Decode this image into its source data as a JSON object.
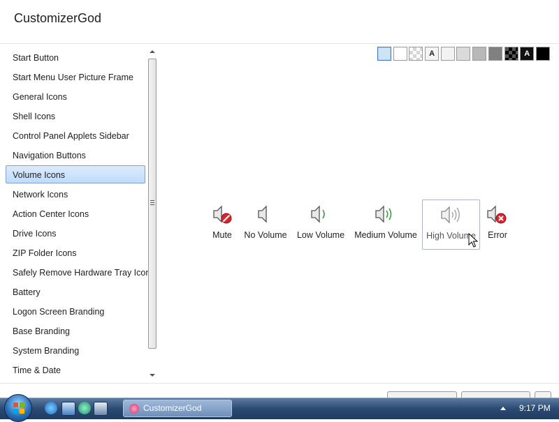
{
  "app": {
    "title": "CustomizerGod"
  },
  "sidebar": {
    "items": [
      {
        "label": "Start Button",
        "selected": false
      },
      {
        "label": "Start Menu User Picture Frame",
        "selected": false
      },
      {
        "label": "General Icons",
        "selected": false
      },
      {
        "label": "Shell Icons",
        "selected": false
      },
      {
        "label": "Control Panel Applets Sidebar",
        "selected": false
      },
      {
        "label": "Navigation Buttons",
        "selected": false
      },
      {
        "label": "Volume Icons",
        "selected": true
      },
      {
        "label": "Network Icons",
        "selected": false
      },
      {
        "label": "Action Center Icons",
        "selected": false
      },
      {
        "label": "Drive Icons",
        "selected": false
      },
      {
        "label": "ZIP Folder Icons",
        "selected": false
      },
      {
        "label": "Safely Remove Hardware Tray Icon",
        "selected": false
      },
      {
        "label": "Battery",
        "selected": false
      },
      {
        "label": "Logon Screen Branding",
        "selected": false
      },
      {
        "label": "Base Branding",
        "selected": false
      },
      {
        "label": "System Branding",
        "selected": false
      },
      {
        "label": "Time & Date",
        "selected": false
      }
    ]
  },
  "swatches": [
    {
      "name": "light-blue",
      "color": "#cfe3f7",
      "text": "",
      "selected": true
    },
    {
      "name": "white",
      "color": "#ffffff",
      "text": ""
    },
    {
      "name": "checker",
      "color": "#eeeeee",
      "text": ""
    },
    {
      "name": "text-a-light",
      "color": "#f4f4f4",
      "text": "A",
      "text_color": "#222222"
    },
    {
      "name": "very-light-gray",
      "color": "#f2f2f2",
      "text": ""
    },
    {
      "name": "light-gray",
      "color": "#dadada",
      "text": ""
    },
    {
      "name": "gray",
      "color": "#b8b8b8",
      "text": ""
    },
    {
      "name": "dark-gray",
      "color": "#808080",
      "text": ""
    },
    {
      "name": "dark-checker",
      "color": "#333333",
      "text": ""
    },
    {
      "name": "text-a-dark",
      "color": "#111111",
      "text": "A",
      "text_color": "#ffffff"
    },
    {
      "name": "black",
      "color": "#000000",
      "text": ""
    }
  ],
  "volume_icons": [
    {
      "label": "Mute",
      "icon": "speaker-mute-icon"
    },
    {
      "label": "No Volume",
      "icon": "speaker-no-volume-icon"
    },
    {
      "label": "Low Volume",
      "icon": "speaker-low-volume-icon"
    },
    {
      "label": "Medium Volume",
      "icon": "speaker-medium-volume-icon"
    },
    {
      "label": "High Volume",
      "icon": "speaker-high-volume-icon",
      "selected": true
    },
    {
      "label": "Error",
      "icon": "speaker-error-icon"
    }
  ],
  "taskbar": {
    "task_label": "CustomizerGod",
    "clock": "9:17 PM"
  }
}
